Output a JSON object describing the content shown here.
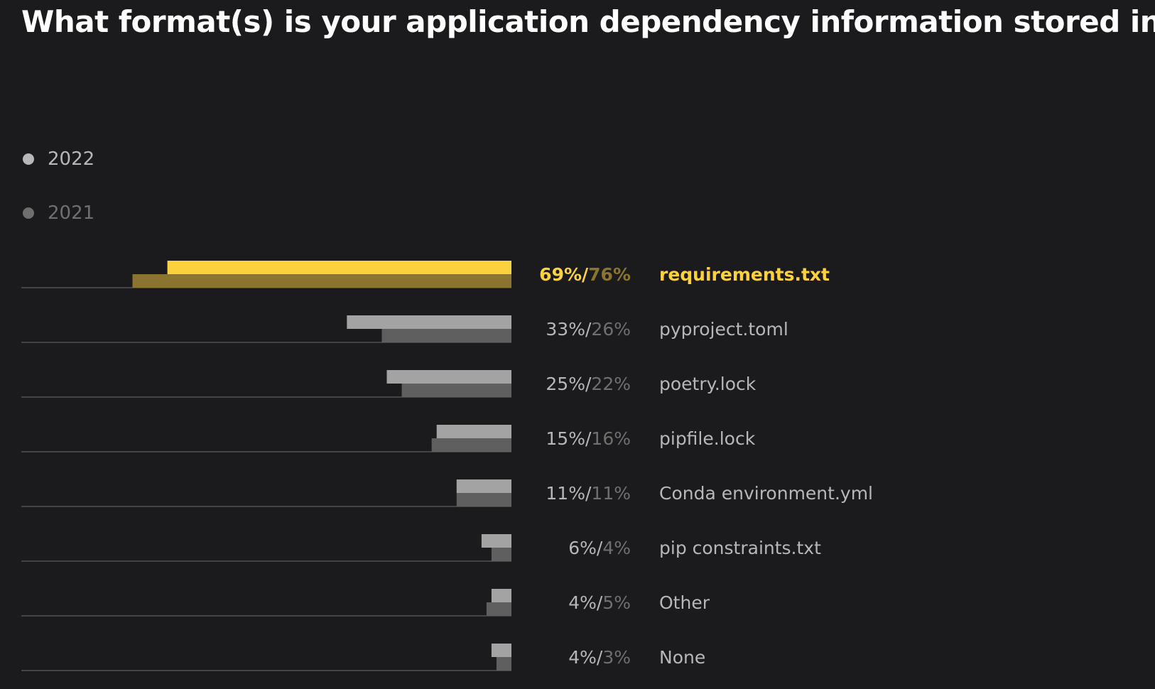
{
  "colors": {
    "background": "#1b1b1d",
    "highlight_current": "#fbd13e",
    "highlight_previous": "#8a7430",
    "current": "#a3a3a3",
    "previous": "#5f5f5f",
    "text_current": "#b7b7b7",
    "text_previous": "#6f6f6f",
    "baseline": "#444444"
  },
  "chart_data": {
    "type": "bar",
    "orientation": "horizontal",
    "title": "What format(s) is your application dependency information stored in?",
    "legend": {
      "placement": "top-left",
      "entries": [
        "2022",
        "2021"
      ]
    },
    "categories": [
      "requirements.txt",
      "pyproject.toml",
      "poetry.lock",
      "pipfile.lock",
      "Conda environment.yml",
      "pip constraints.txt",
      "Other",
      "None"
    ],
    "series": [
      {
        "name": "2022",
        "values": [
          69,
          33,
          25,
          15,
          11,
          6,
          4,
          4
        ]
      },
      {
        "name": "2021",
        "values": [
          76,
          26,
          22,
          16,
          11,
          4,
          5,
          3
        ]
      }
    ],
    "value_labels_current": [
      "69%",
      "33%",
      "25%",
      "15%",
      "11%",
      "6%",
      "4%",
      "4%"
    ],
    "value_labels_previous": [
      "76%",
      "26%",
      "22%",
      "16%",
      "11%",
      "4%",
      "5%",
      "3%"
    ],
    "separator": "/",
    "highlighted_category": "requirements.txt",
    "xlim": [
      0,
      100
    ],
    "grid": false
  }
}
